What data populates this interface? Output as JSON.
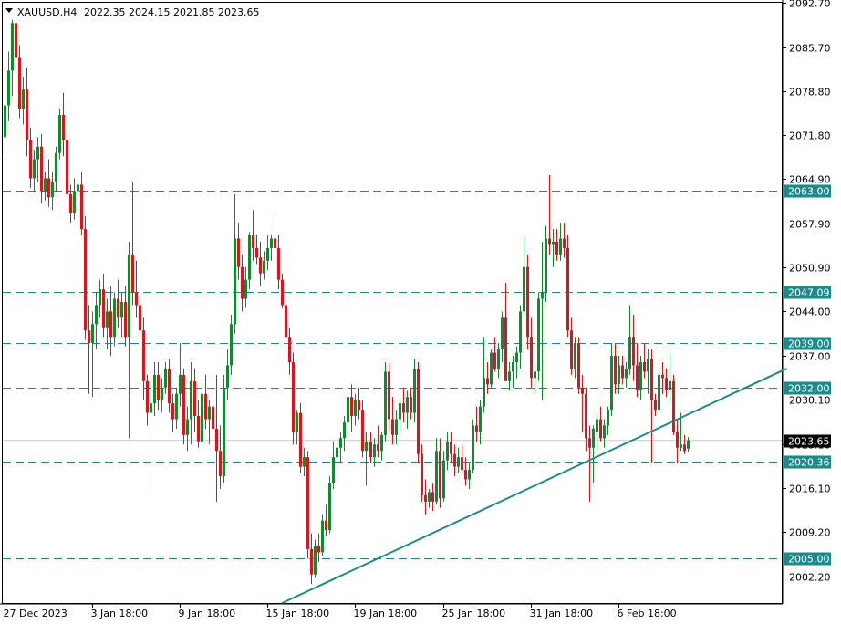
{
  "header": {
    "symbol": "XAUUSD,H4",
    "ohlc": "2022.35 2024.15 2021.85 2023.65"
  },
  "colors": {
    "bull": "#0f8a2e",
    "bear": "#e0121b",
    "level_line": "#1a8a8a",
    "trend_line": "#1a8a8a",
    "price_line": "#c8c8c8",
    "price_label_bg": "#000000",
    "level_label_bg": "#1a8a8a"
  },
  "chart_data": {
    "type": "candlestick",
    "instrument": "XAUUSD",
    "timeframe": "H4",
    "ylim": [
      1998.0,
      2092.7
    ],
    "y_ticks": [
      "2092.70",
      "2085.70",
      "2078.80",
      "2071.80",
      "2064.90",
      "2057.90",
      "2050.90",
      "2044.00",
      "2037.00",
      "2030.10",
      "2023.10",
      "2016.10",
      "2009.20",
      "2002.20"
    ],
    "x_ticks": [
      {
        "label": "27 Dec 2023",
        "bar": 0
      },
      {
        "label": "3 Jan 18:00",
        "bar": 24
      },
      {
        "label": "9 Jan 18:00",
        "bar": 48
      },
      {
        "label": "15 Jan 18:00",
        "bar": 72
      },
      {
        "label": "19 Jan 18:00",
        "bar": 96
      },
      {
        "label": "25 Jan 18:00",
        "bar": 120
      },
      {
        "label": "31 Jan 18:00",
        "bar": 144
      },
      {
        "label": "6 Feb 18:00",
        "bar": 168
      }
    ],
    "horizontal_levels": [
      "2063.00",
      "2047.09",
      "2039.00",
      "2032.00",
      "2020.36",
      "2005.00"
    ],
    "current_price": "2023.65",
    "trendline": [
      {
        "bar": 76,
        "price": 1998.0
      },
      {
        "bar": 214,
        "price": 2035.0
      }
    ],
    "candles": [
      [
        2071.5,
        2078.0,
        2068.8,
        2076.5
      ],
      [
        2076.5,
        2085.0,
        2074.0,
        2082.0
      ],
      [
        2082.0,
        2090.0,
        2078.0,
        2089.5
      ],
      [
        2089.5,
        2091.0,
        2082.5,
        2084.0
      ],
      [
        2084.0,
        2086.0,
        2074.5,
        2076.0
      ],
      [
        2076.0,
        2081.0,
        2073.5,
        2079.0
      ],
      [
        2079.0,
        2082.5,
        2068.5,
        2071.0
      ],
      [
        2071.0,
        2073.0,
        2063.5,
        2065.0
      ],
      [
        2065.0,
        2069.5,
        2063.0,
        2068.0
      ],
      [
        2068.0,
        2071.5,
        2064.5,
        2070.0
      ],
      [
        2070.0,
        2072.0,
        2061.0,
        2063.0
      ],
      [
        2063.0,
        2066.0,
        2061.5,
        2065.0
      ],
      [
        2065.0,
        2068.0,
        2060.5,
        2062.0
      ],
      [
        2062.0,
        2066.0,
        2060.0,
        2064.5
      ],
      [
        2064.5,
        2070.0,
        2063.0,
        2069.0
      ],
      [
        2069.0,
        2076.0,
        2068.0,
        2075.0
      ],
      [
        2075.0,
        2078.5,
        2068.5,
        2071.0
      ],
      [
        2071.0,
        2072.0,
        2060.0,
        2062.5
      ],
      [
        2062.5,
        2064.0,
        2058.0,
        2059.5
      ],
      [
        2059.5,
        2065.0,
        2058.5,
        2063.0
      ],
      [
        2063.0,
        2066.0,
        2062.0,
        2064.0
      ],
      [
        2064.0,
        2066.0,
        2056.0,
        2057.0
      ],
      [
        2057.0,
        2059.0,
        2039.5,
        2041.0
      ],
      [
        2041.0,
        2045.0,
        2031.0,
        2039.0
      ],
      [
        2039.0,
        2044.0,
        2030.5,
        2042.0
      ],
      [
        2042.0,
        2047.0,
        2038.0,
        2045.0
      ],
      [
        2045.0,
        2049.0,
        2043.0,
        2047.5
      ],
      [
        2047.5,
        2050.0,
        2040.0,
        2041.5
      ],
      [
        2041.5,
        2046.0,
        2038.0,
        2044.0
      ],
      [
        2044.0,
        2048.0,
        2037.0,
        2040.0
      ],
      [
        2040.0,
        2047.0,
        2038.5,
        2046.0
      ],
      [
        2046.0,
        2049.0,
        2041.5,
        2043.0
      ],
      [
        2043.0,
        2047.0,
        2040.0,
        2045.5
      ],
      [
        2045.5,
        2048.0,
        2038.5,
        2040.0
      ],
      [
        2040.0,
        2055.0,
        2024.0,
        2053.0
      ],
      [
        2053.0,
        2064.5,
        2045.0,
        2047.0
      ],
      [
        2047.0,
        2052.0,
        2043.0,
        2045.0
      ],
      [
        2045.0,
        2047.0,
        2039.5,
        2041.0
      ],
      [
        2041.0,
        2043.0,
        2030.0,
        2033.0
      ],
      [
        2033.0,
        2034.0,
        2026.0,
        2028.0
      ],
      [
        2028.0,
        2032.0,
        2017.0,
        2029.5
      ],
      [
        2029.5,
        2036.0,
        2027.5,
        2034.0
      ],
      [
        2034.0,
        2036.0,
        2028.5,
        2030.0
      ],
      [
        2030.0,
        2033.5,
        2028.0,
        2032.0
      ],
      [
        2032.0,
        2036.0,
        2031.0,
        2035.0
      ],
      [
        2035.0,
        2036.5,
        2028.0,
        2029.5
      ],
      [
        2029.5,
        2031.0,
        2025.0,
        2027.0
      ],
      [
        2027.0,
        2032.0,
        2025.5,
        2031.0
      ],
      [
        2031.0,
        2039.0,
        2029.0,
        2034.0
      ],
      [
        2034.0,
        2035.0,
        2023.0,
        2024.5
      ],
      [
        2024.5,
        2029.0,
        2022.0,
        2027.0
      ],
      [
        2027.0,
        2036.0,
        2023.0,
        2033.0
      ],
      [
        2033.0,
        2035.0,
        2025.0,
        2027.5
      ],
      [
        2027.5,
        2030.0,
        2022.5,
        2023.5
      ],
      [
        2023.5,
        2033.0,
        2022.0,
        2031.0
      ],
      [
        2031.0,
        2034.0,
        2025.5,
        2027.0
      ],
      [
        2027.0,
        2030.0,
        2023.0,
        2029.0
      ],
      [
        2029.0,
        2031.0,
        2024.5,
        2025.5
      ],
      [
        2025.5,
        2034.0,
        2014.0,
        2022.0
      ],
      [
        2022.0,
        2026.0,
        2016.0,
        2018.0
      ],
      [
        2018.0,
        2034.0,
        2017.0,
        2032.0
      ],
      [
        2032.0,
        2038.0,
        2030.0,
        2035.5
      ],
      [
        2035.5,
        2043.5,
        2034.0,
        2042.0
      ],
      [
        2042.0,
        2062.5,
        2040.5,
        2055.5
      ],
      [
        2055.5,
        2058.0,
        2049.0,
        2051.0
      ],
      [
        2051.0,
        2053.0,
        2044.0,
        2046.0
      ],
      [
        2046.0,
        2051.0,
        2044.5,
        2049.0
      ],
      [
        2049.0,
        2056.5,
        2047.5,
        2056.0
      ],
      [
        2056.0,
        2060.0,
        2052.0,
        2054.0
      ],
      [
        2054.0,
        2056.0,
        2051.5,
        2052.5
      ],
      [
        2052.5,
        2055.0,
        2048.0,
        2050.0
      ],
      [
        2050.0,
        2053.5,
        2049.0,
        2052.0
      ],
      [
        2052.0,
        2056.0,
        2050.5,
        2054.0
      ],
      [
        2054.0,
        2056.0,
        2052.0,
        2055.5
      ],
      [
        2055.5,
        2059.0,
        2052.5,
        2054.0
      ],
      [
        2054.0,
        2056.0,
        2047.5,
        2049.0
      ],
      [
        2049.0,
        2050.0,
        2044.5,
        2045.0
      ],
      [
        2045.0,
        2047.0,
        2038.0,
        2040.0
      ],
      [
        2040.0,
        2041.5,
        2034.0,
        2036.0
      ],
      [
        2036.0,
        2037.5,
        2023.0,
        2025.0
      ],
      [
        2025.0,
        2028.5,
        2023.0,
        2028.0
      ],
      [
        2028.0,
        2029.5,
        2018.5,
        2019.5
      ],
      [
        2019.5,
        2022.5,
        2018.0,
        2021.0
      ],
      [
        2021.0,
        2022.0,
        2005.0,
        2006.5
      ],
      [
        2006.5,
        2009.0,
        2001.0,
        2002.5
      ],
      [
        2002.5,
        2008.0,
        2002.0,
        2007.0
      ],
      [
        2007.0,
        2009.0,
        2004.5,
        2006.0
      ],
      [
        2006.0,
        2012.0,
        2005.5,
        2011.0
      ],
      [
        2011.0,
        2013.5,
        2008.5,
        2009.5
      ],
      [
        2009.5,
        2018.0,
        2009.0,
        2017.0
      ],
      [
        2017.0,
        2023.5,
        2016.0,
        2021.0
      ],
      [
        2021.0,
        2023.0,
        2019.5,
        2022.5
      ],
      [
        2022.5,
        2025.0,
        2020.0,
        2024.0
      ],
      [
        2024.0,
        2027.5,
        2022.0,
        2026.5
      ],
      [
        2026.5,
        2031.0,
        2024.0,
        2030.5
      ],
      [
        2030.5,
        2032.5,
        2025.0,
        2027.5
      ],
      [
        2027.5,
        2031.0,
        2026.0,
        2030.0
      ],
      [
        2030.0,
        2032.0,
        2027.0,
        2028.5
      ],
      [
        2028.5,
        2030.0,
        2021.0,
        2022.0
      ],
      [
        2022.0,
        2025.0,
        2016.5,
        2023.5
      ],
      [
        2023.5,
        2025.0,
        2020.0,
        2021.0
      ],
      [
        2021.0,
        2024.0,
        2019.5,
        2023.0
      ],
      [
        2023.0,
        2026.0,
        2021.0,
        2022.0
      ],
      [
        2022.0,
        2025.0,
        2020.5,
        2024.5
      ],
      [
        2024.5,
        2036.0,
        2023.5,
        2034.5
      ],
      [
        2034.5,
        2036.0,
        2025.0,
        2027.0
      ],
      [
        2027.0,
        2030.5,
        2023.0,
        2024.5
      ],
      [
        2024.5,
        2028.5,
        2023.0,
        2027.0
      ],
      [
        2027.0,
        2030.5,
        2025.0,
        2029.5
      ],
      [
        2029.5,
        2032.0,
        2026.5,
        2028.0
      ],
      [
        2028.0,
        2031.5,
        2025.5,
        2030.5
      ],
      [
        2030.5,
        2032.0,
        2027.0,
        2028.0
      ],
      [
        2028.0,
        2036.5,
        2026.5,
        2035.0
      ],
      [
        2035.0,
        2036.0,
        2020.0,
        2021.5
      ],
      [
        2021.5,
        2023.0,
        2014.0,
        2015.0
      ],
      [
        2015.0,
        2017.5,
        2012.0,
        2014.0
      ],
      [
        2014.0,
        2016.0,
        2013.0,
        2015.5
      ],
      [
        2015.5,
        2017.0,
        2012.5,
        2014.0
      ],
      [
        2014.0,
        2024.0,
        2013.5,
        2022.0
      ],
      [
        2022.0,
        2024.0,
        2013.0,
        2014.5
      ],
      [
        2014.5,
        2022.0,
        2014.0,
        2020.5
      ],
      [
        2020.5,
        2025.0,
        2019.0,
        2023.5
      ],
      [
        2023.5,
        2025.0,
        2020.0,
        2021.5
      ],
      [
        2021.5,
        2023.0,
        2018.0,
        2019.5
      ],
      [
        2019.5,
        2022.5,
        2018.5,
        2021.0
      ],
      [
        2021.0,
        2023.0,
        2018.5,
        2019.0
      ],
      [
        2019.0,
        2021.0,
        2016.5,
        2017.5
      ],
      [
        2017.5,
        2020.0,
        2016.0,
        2019.0
      ],
      [
        2019.0,
        2027.0,
        2018.5,
        2026.0
      ],
      [
        2026.0,
        2029.0,
        2023.5,
        2025.0
      ],
      [
        2025.0,
        2030.0,
        2023.0,
        2029.0
      ],
      [
        2029.0,
        2040.0,
        2028.0,
        2033.5
      ],
      [
        2033.5,
        2036.0,
        2031.0,
        2032.5
      ],
      [
        2032.5,
        2038.0,
        2032.0,
        2037.5
      ],
      [
        2037.5,
        2040.0,
        2034.5,
        2035.0
      ],
      [
        2035.0,
        2039.0,
        2033.5,
        2038.0
      ],
      [
        2038.0,
        2044.0,
        2036.0,
        2043.0
      ],
      [
        2043.0,
        2048.5,
        2041.0,
        2033.0
      ],
      [
        2033.0,
        2036.0,
        2031.5,
        2034.5
      ],
      [
        2034.5,
        2037.0,
        2032.0,
        2036.0
      ],
      [
        2036.0,
        2038.5,
        2033.5,
        2037.5
      ],
      [
        2037.5,
        2045.0,
        2035.0,
        2044.0
      ],
      [
        2044.0,
        2056.0,
        2043.0,
        2051.0
      ],
      [
        2051.0,
        2053.0,
        2038.0,
        2040.0
      ],
      [
        2040.0,
        2043.0,
        2032.0,
        2033.5
      ],
      [
        2033.5,
        2036.0,
        2031.0,
        2034.5
      ],
      [
        2034.5,
        2047.0,
        2033.0,
        2046.0
      ],
      [
        2046.0,
        2055.0,
        2030.0,
        2047.0
      ],
      [
        2047.0,
        2057.5,
        2045.5,
        2055.5
      ],
      [
        2055.5,
        2065.5,
        2053.0,
        2054.5
      ],
      [
        2054.5,
        2057.0,
        2051.0,
        2055.0
      ],
      [
        2055.0,
        2057.0,
        2052.0,
        2053.0
      ],
      [
        2053.0,
        2058.0,
        2052.0,
        2055.5
      ],
      [
        2055.5,
        2058.0,
        2052.5,
        2054.0
      ],
      [
        2054.0,
        2056.0,
        2040.0,
        2041.0
      ],
      [
        2041.0,
        2043.0,
        2034.0,
        2035.0
      ],
      [
        2035.0,
        2040.0,
        2033.5,
        2039.0
      ],
      [
        2039.0,
        2040.0,
        2031.0,
        2032.0
      ],
      [
        2032.0,
        2034.0,
        2025.0,
        2031.0
      ],
      [
        2031.0,
        2032.0,
        2022.0,
        2024.0
      ],
      [
        2024.0,
        2026.0,
        2014.0,
        2022.5
      ],
      [
        2022.5,
        2026.0,
        2017.0,
        2025.5
      ],
      [
        2025.0,
        2028.0,
        2022.0,
        2027.0
      ],
      [
        2027.0,
        2029.0,
        2023.5,
        2024.0
      ],
      [
        2024.0,
        2027.0,
        2022.5,
        2026.0
      ],
      [
        2026.0,
        2029.0,
        2024.5,
        2028.5
      ],
      [
        2028.5,
        2039.0,
        2027.5,
        2037.0
      ],
      [
        2037.0,
        2039.0,
        2031.0,
        2032.5
      ],
      [
        2032.5,
        2037.0,
        2031.0,
        2035.5
      ],
      [
        2035.5,
        2037.0,
        2032.5,
        2033.5
      ],
      [
        2033.5,
        2036.0,
        2032.0,
        2035.0
      ],
      [
        2035.0,
        2045.0,
        2034.0,
        2040.0
      ],
      [
        2040.0,
        2043.5,
        2033.0,
        2035.5
      ],
      [
        2035.5,
        2039.0,
        2030.5,
        2031.5
      ],
      [
        2031.5,
        2037.0,
        2030.0,
        2036.0
      ],
      [
        2036.0,
        2039.0,
        2033.5,
        2034.5
      ],
      [
        2034.5,
        2038.0,
        2031.0,
        2036.5
      ],
      [
        2036.5,
        2038.0,
        2020.0,
        2030.0
      ],
      [
        2030.0,
        2031.0,
        2027.5,
        2028.5
      ],
      [
        2028.5,
        2035.0,
        2028.0,
        2034.0
      ],
      [
        2034.0,
        2036.0,
        2031.0,
        2033.5
      ],
      [
        2033.5,
        2035.0,
        2030.5,
        2031.5
      ],
      [
        2031.5,
        2037.5,
        2029.5,
        2033.0
      ],
      [
        2033.0,
        2034.0,
        2024.5,
        2025.0
      ],
      [
        2025.0,
        2027.0,
        2020.0,
        2022.5
      ],
      [
        2022.5,
        2028.0,
        2022.0,
        2023.0
      ],
      [
        2023.0,
        2024.5,
        2021.5,
        2022.0
      ],
      [
        2022.35,
        2024.15,
        2021.85,
        2023.65
      ]
    ]
  }
}
